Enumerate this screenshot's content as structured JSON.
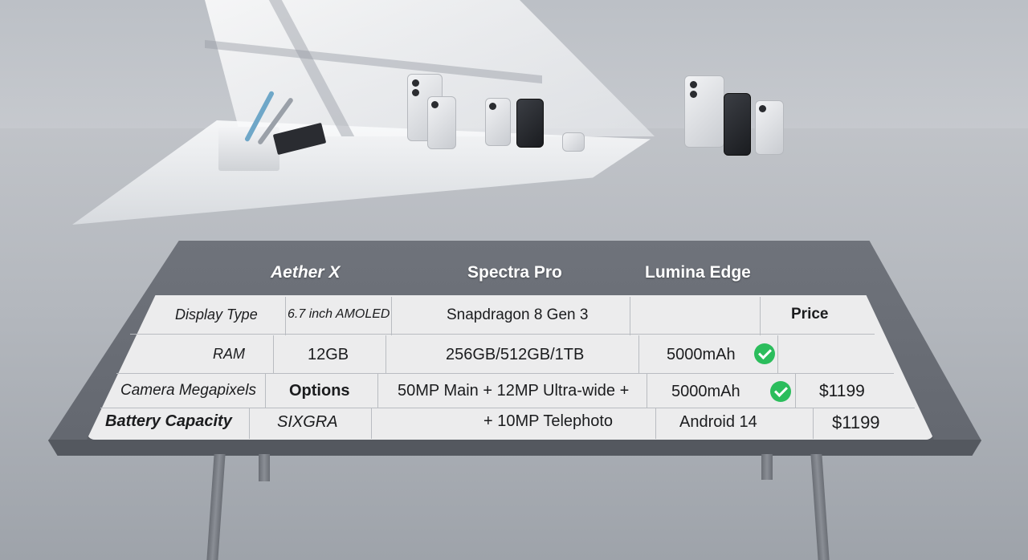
{
  "headers": {
    "col1": "Aether X",
    "col2": "Spectra Pro",
    "col3": "Lumina Edge"
  },
  "rows": [
    {
      "label": "Display Type",
      "c1": "6.7 inch AMOLED",
      "c2": "Snapdragon 8 Gen 3",
      "c3": "",
      "c4": "Price"
    },
    {
      "label": "RAM",
      "c1": "12GB",
      "c2": "256GB/512GB/1TB",
      "c3": "5000mAh",
      "c4": ""
    },
    {
      "label": "Camera Megapixels",
      "c1": "Options",
      "c2": "50MP Main + 12MP Ultra-wide +",
      "c3": "5000mAh",
      "c4": "$1199"
    },
    {
      "label": "Battery Capacity",
      "c1": "SIXGRA",
      "c2": "+ 10MP Telephoto",
      "c3": "Android 14",
      "c4": "$1199"
    }
  ],
  "icons": {
    "check_row2": "check-icon",
    "check_row3": "check-icon"
  },
  "colors": {
    "check": "#2bbd5c",
    "table_surface": "#65696f",
    "grid_background": "#ececed"
  }
}
